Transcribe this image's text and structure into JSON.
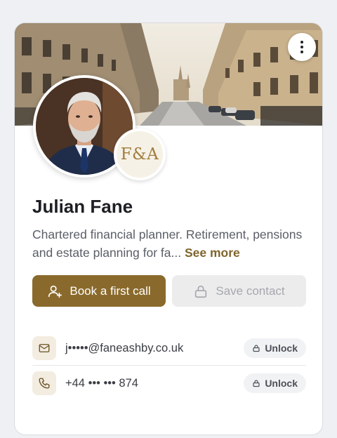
{
  "profile": {
    "name": "Julian Fane",
    "bio_text": "Chartered financial planner. Retirement, pensions and estate planning for fa...",
    "see_more_label": "See more",
    "logo_initials": "F&A"
  },
  "actions": {
    "book_label": "Book a first call",
    "save_label": "Save contact"
  },
  "contacts": [
    {
      "type": "email",
      "icon": "mail-icon",
      "value": "j•••••@faneashby.co.uk",
      "unlock_label": "Unlock"
    },
    {
      "type": "phone",
      "icon": "phone-icon",
      "value": "+44 ••• ••• 874",
      "unlock_label": "Unlock"
    }
  ],
  "colors": {
    "accent": "#8a6a2c",
    "link": "#7f652c",
    "disabled_bg": "#ececed"
  }
}
